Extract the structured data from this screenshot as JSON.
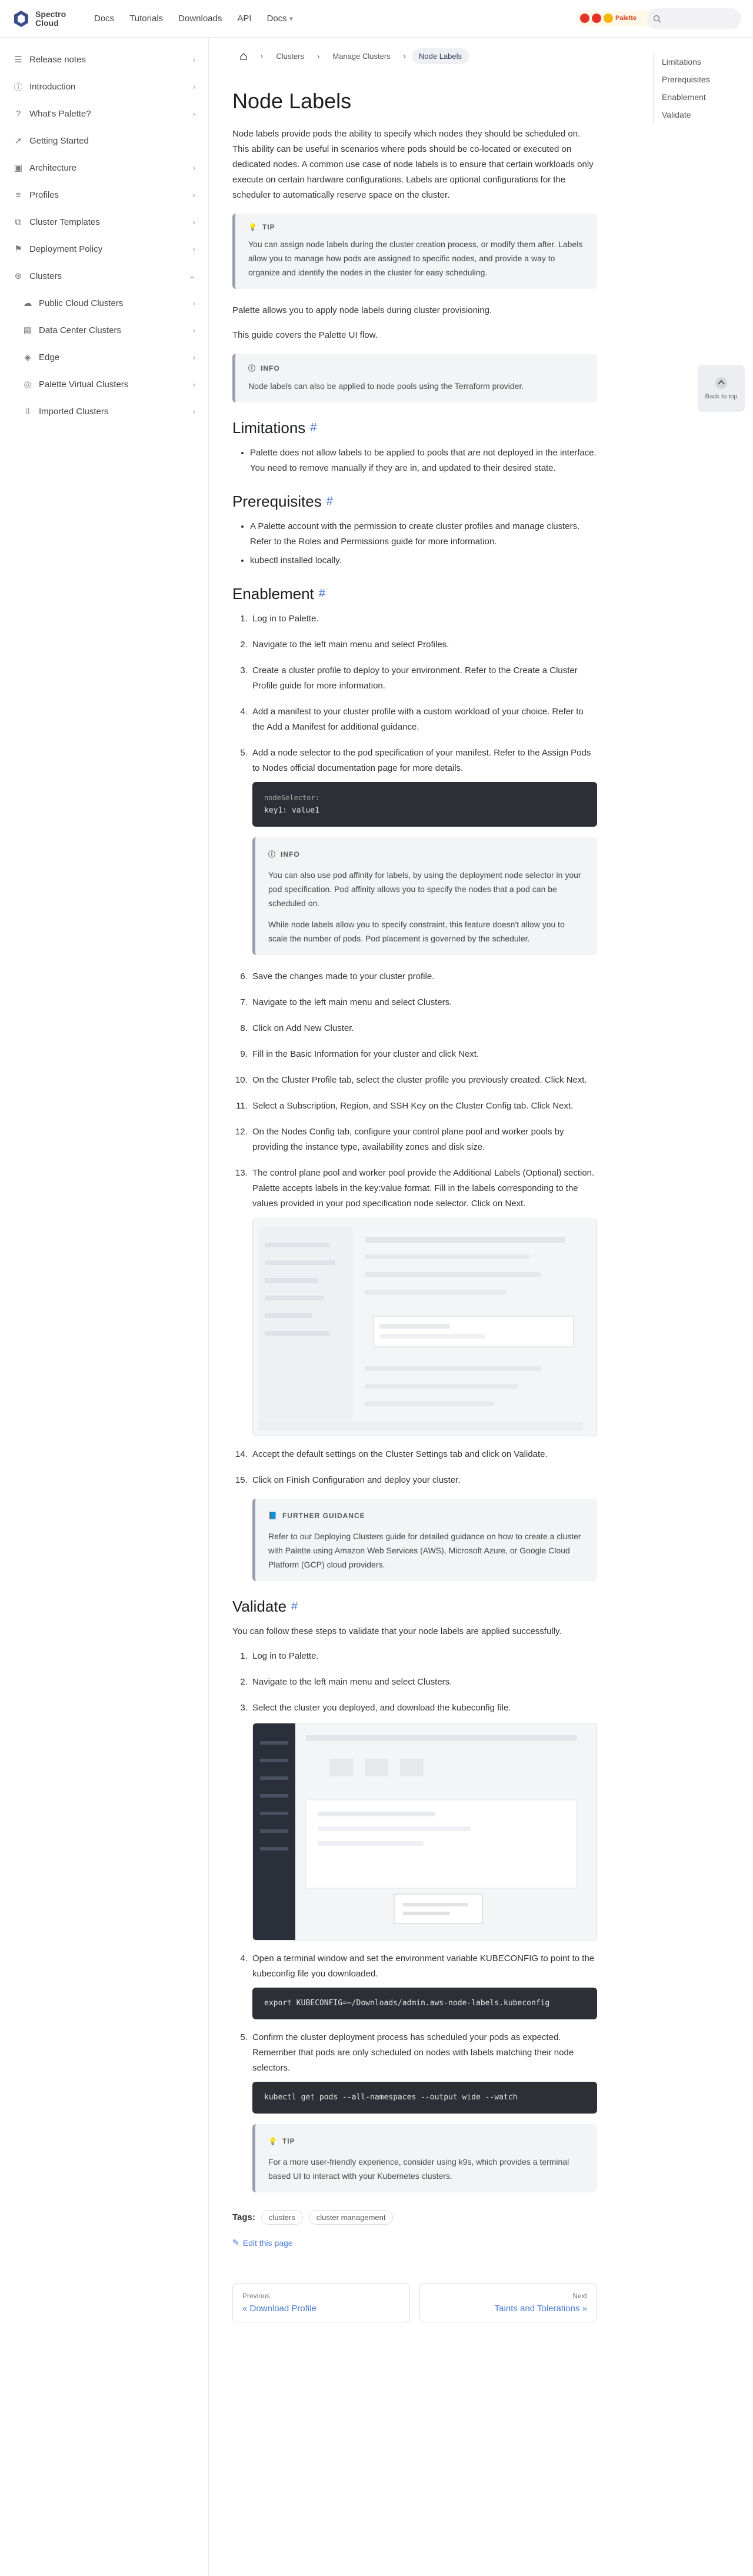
{
  "navbar": {
    "logo_text_1": "Spectro",
    "logo_text_2": "Cloud",
    "links": [
      "Docs",
      "Tutorials",
      "Downloads",
      "API",
      "Docs"
    ],
    "search_placeholder": "",
    "banner_text": "Palette"
  },
  "sidebar": {
    "items": [
      {
        "label": "Release notes"
      },
      {
        "label": "Introduction"
      },
      {
        "label": "What's Palette?"
      },
      {
        "label": "Getting Started"
      },
      {
        "label": "Architecture"
      },
      {
        "label": "Profiles"
      },
      {
        "label": "Cluster Templates"
      },
      {
        "label": "Deployment Policy"
      },
      {
        "label": "Clusters"
      }
    ],
    "children": [
      {
        "label": "Public Cloud Clusters"
      },
      {
        "label": "Data Center Clusters"
      },
      {
        "label": "Edge"
      },
      {
        "label": "Palette Virtual Clusters"
      },
      {
        "label": "Imported Clusters"
      }
    ]
  },
  "breadcrumb": {
    "items": [
      "Clusters",
      "Manage Clusters",
      "Node Labels"
    ]
  },
  "page": {
    "title": "Node Labels",
    "intro": "Node labels provide pods the ability to specify which nodes they should be scheduled on. This ability can be useful in scenarios where pods should be co-located or executed on dedicated nodes. A common use case of node labels is to ensure that certain workloads only execute on certain hardware configurations. Labels are optional configurations for the scheduler to automatically reserve space on the cluster.",
    "tip1_head": "TIP",
    "tip1_text": "You can assign node labels during the cluster creation process, or modify them after. Labels allow you to manage how pods are assigned to specific nodes, and provide a way to organize and identify the nodes in the cluster for easy scheduling.",
    "taints_line": "Palette allows you to apply node labels during cluster provisioning.",
    "guide_line": "This guide covers the Palette UI flow.",
    "info_head": "INFO",
    "info_text": "Node labels can also be applied to node pools using the Terraform provider.",
    "limitations_title": "Limitations",
    "limitations": [
      "Palette does not allow labels to be applied to pools that are not deployed in the interface. You need to remove manually if they are in, and updated to their desired state."
    ],
    "prereq_title": "Prerequisites",
    "prereqs": [
      "A Palette account with the permission to create cluster profiles and manage clusters. Refer to the Roles and Permissions guide for more information.",
      "kubectl installed locally."
    ],
    "enable_title": "Enablement",
    "steps": [
      "Log in to Palette.",
      "Navigate to the left main menu and select Profiles.",
      "Create a cluster profile to deploy to your environment. Refer to the Create a Cluster Profile guide for more information.",
      "Add a manifest to your cluster profile with a custom workload of your choice. Refer to the Add a Manifest for additional guidance.",
      "Add a node selector to the pod specification of your manifest. Refer to the Assign Pods to Nodes official documentation page for more details.",
      "Save the changes made to your cluster profile.",
      "Navigate to the left main menu and select Clusters.",
      "Click on Add New Cluster.",
      "Fill in the Basic Information for your cluster and click Next.",
      "On the Cluster Profile tab, select the cluster profile you previously created. Click Next.",
      "Select a Subscription, Region, and SSH Key on the Cluster Config tab. Click Next.",
      "On the Nodes Config tab, configure your control plane pool and worker pools by providing the instance type, availability zones and disk size.",
      "The control plane pool and worker pool provide the Additional Labels (Optional) section. Palette accepts labels in the key:value format. Fill in the labels corresponding to the values provided in your pod specification node selector. Click on Next.",
      "Accept the default settings on the Cluster Settings tab and click on Validate.",
      "Click on Finish Configuration and deploy your cluster."
    ],
    "code1_lang": "nodeSelector:",
    "code1_line": "  key1: value1",
    "info2_head": "INFO",
    "info2_text1": "You can also use pod affinity for labels, by using the deployment node selector in your pod specification. Pod affinity allows you to specify the nodes that a pod can be scheduled on.",
    "info2_text2": "While node labels allow you to specify constraint, this feature doesn't allow you to scale the number of pods. Pod placement is governed by the scheduler.",
    "further_head": "FURTHER GUIDANCE",
    "further_text": "Refer to our Deploying Clusters guide for detailed guidance on how to create a cluster with Palette using Amazon Web Services (AWS), Microsoft Azure, or Google Cloud Platform (GCP) cloud providers.",
    "validate_title": "Validate",
    "validate_intro": "You can follow these steps to validate that your node labels are applied successfully.",
    "vsteps": [
      "Log in to Palette.",
      "Navigate to the left main menu and select Clusters.",
      "Select the cluster you deployed, and download the kubeconfig file.",
      "Open a terminal window and set the environment variable KUBECONFIG to point to the kubeconfig file you downloaded.",
      "Confirm the cluster deployment process has scheduled your pods as expected. Remember that pods are only scheduled on nodes with labels matching their node selectors."
    ],
    "code2": "export KUBECONFIG=~/Downloads/admin.aws-node-labels.kubeconfig",
    "code3": "kubectl get pods --all-namespaces --output wide --watch",
    "tip2_head": "TIP",
    "tip2_text": "For a more user-friendly experience, consider using k9s, which provides a terminal based UI to interact with your Kubernetes clusters.",
    "tags_label": "Tags:",
    "tags": [
      "clusters",
      "cluster management"
    ],
    "edit_label": "Edit this page",
    "prev_sub": "Previous",
    "prev_title": "« Download Profile",
    "next_sub": "Next",
    "next_title": "Taints and Tolerations »"
  },
  "toc": {
    "items": [
      "Limitations",
      "Prerequisites",
      "Enablement",
      "Validate"
    ]
  },
  "back_top": "Back to top"
}
